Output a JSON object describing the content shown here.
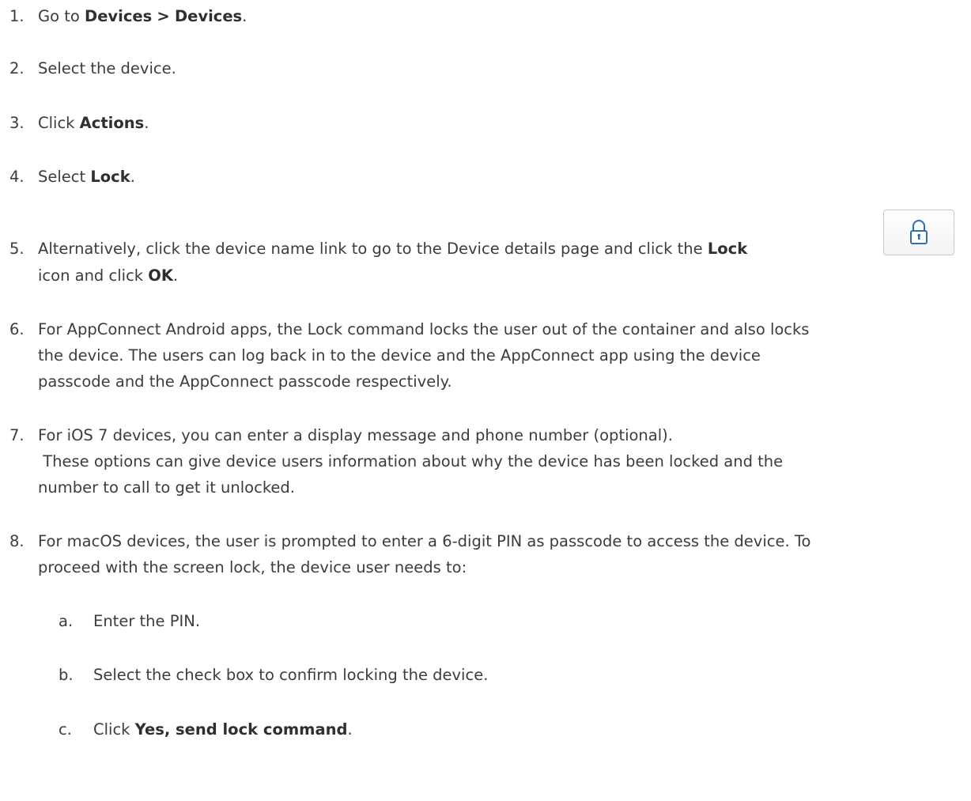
{
  "steps": [
    {
      "num": "1.",
      "parts": [
        "Go to ",
        "Devices",
        " ",
        ">",
        " ",
        "Devices",
        "."
      ]
    },
    {
      "num": "2.",
      "text": "Select the device."
    },
    {
      "num": "3.",
      "parts": [
        "Click ",
        "Actions",
        "."
      ]
    },
    {
      "num": "4.",
      "parts": [
        "Select ",
        "Lock",
        "."
      ]
    },
    {
      "num": "5.",
      "parts": [
        "Alternatively, click the device name link to go to the Device details page and click the ",
        "Lock",
        "icon and click ",
        "OK",
        "."
      ]
    },
    {
      "num": "6.",
      "line1": "For AppConnect Android apps, the Lock command locks the user out of the container and also locks",
      "line2": "the device. The users can log back in to the device and the AppConnect app using the device",
      "line3": "passcode and the AppConnect passcode respectively."
    },
    {
      "num": "7.",
      "line1": "For iOS 7 devices, you can enter a display message and phone number (optional).",
      "line2": " These options can give device users information about why the device has been locked and the",
      "line3": "number to call to get it unlocked."
    },
    {
      "num": "8.",
      "line1": "For macOS devices, the user is prompted to enter a 6-digit PIN as passcode to access the device. To",
      "line2": "proceed with the screen lock, the device user needs to:"
    }
  ],
  "substeps": [
    {
      "num": "a.",
      "text": "Enter the PIN."
    },
    {
      "num": "b.",
      "text": "Select the check box to confirm locking the device."
    },
    {
      "num": "c.",
      "parts": [
        "Click ",
        "Yes, send lock command",
        "."
      ]
    }
  ],
  "icons": {
    "lock_button": "lock-icon"
  },
  "colors": {
    "text": "#3c3c3c",
    "icon": "#2e6fb0"
  }
}
